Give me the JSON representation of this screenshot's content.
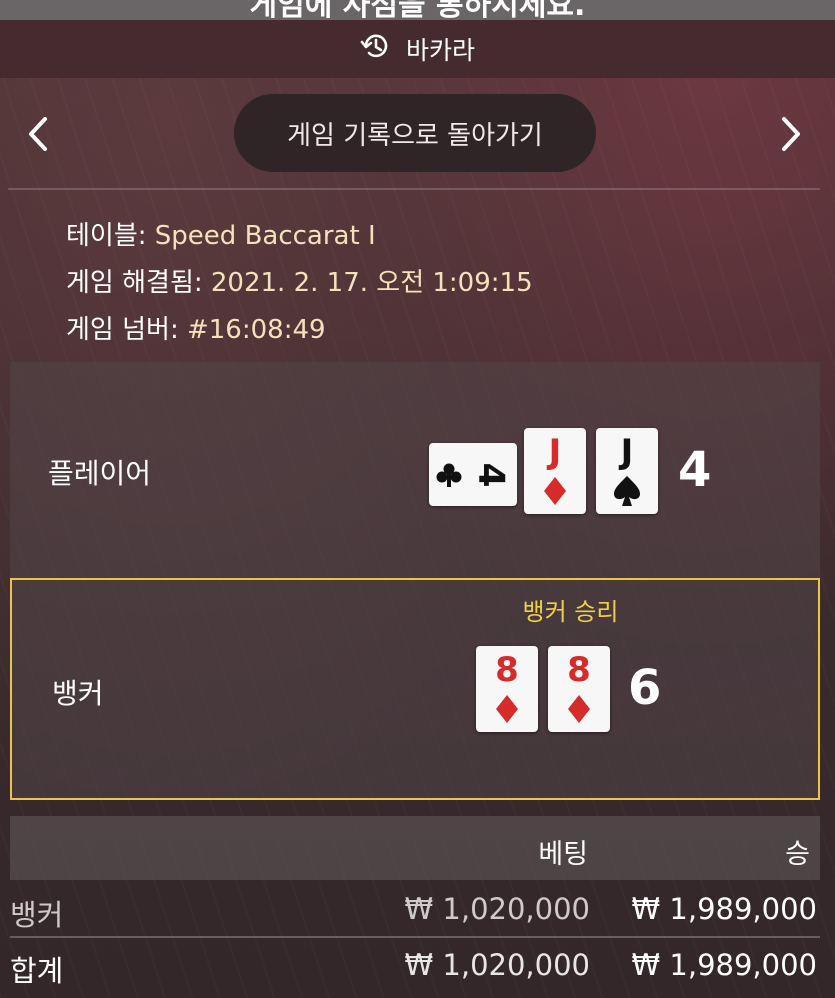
{
  "banner": {
    "text": "게임에 사점을 통하시세요."
  },
  "header": {
    "history_icon": "history-icon",
    "title": "바카라"
  },
  "nav": {
    "prev_icon": "chevron-left-icon",
    "next_icon": "chevron-right-icon",
    "back_label": "게임 기록으로 돌아가기"
  },
  "info": {
    "table_label": "테이블:",
    "table_value": "Speed Baccarat I",
    "resolved_label": "게임 해결됨:",
    "resolved_value": "2021. 2. 17. 오전 1:09:15",
    "number_label": "게임 넘버:",
    "number_value": "#16:08:49"
  },
  "player": {
    "label": "플레이어",
    "score": "4",
    "cards": [
      {
        "rank": "4",
        "suit": "clubs",
        "color": "#111111",
        "rotated": true
      },
      {
        "rank": "J",
        "suit": "diamonds",
        "color": "#d62b2b",
        "rotated": false
      },
      {
        "rank": "J",
        "suit": "spades",
        "color": "#111111",
        "rotated": false
      }
    ]
  },
  "banker": {
    "label": "뱅커",
    "win_text": "뱅커 승리",
    "score": "6",
    "cards": [
      {
        "rank": "8",
        "suit": "diamonds",
        "color": "#d62b2b",
        "rotated": false
      },
      {
        "rank": "8",
        "suit": "diamonds",
        "color": "#d62b2b",
        "rotated": false
      }
    ]
  },
  "bets": {
    "col_bet": "베팅",
    "col_win": "승",
    "rows": [
      {
        "name": "뱅커",
        "bet": "₩ 1,020,000",
        "win": "₩ 1,989,000"
      },
      {
        "name": "합계",
        "bet": "₩ 1,020,000",
        "win": "₩ 1,989,000"
      }
    ]
  },
  "colors": {
    "accent_gold": "#e7c64a",
    "info_value": "#f3e2bb",
    "red_suit": "#d62b2b",
    "black_suit": "#111111"
  }
}
